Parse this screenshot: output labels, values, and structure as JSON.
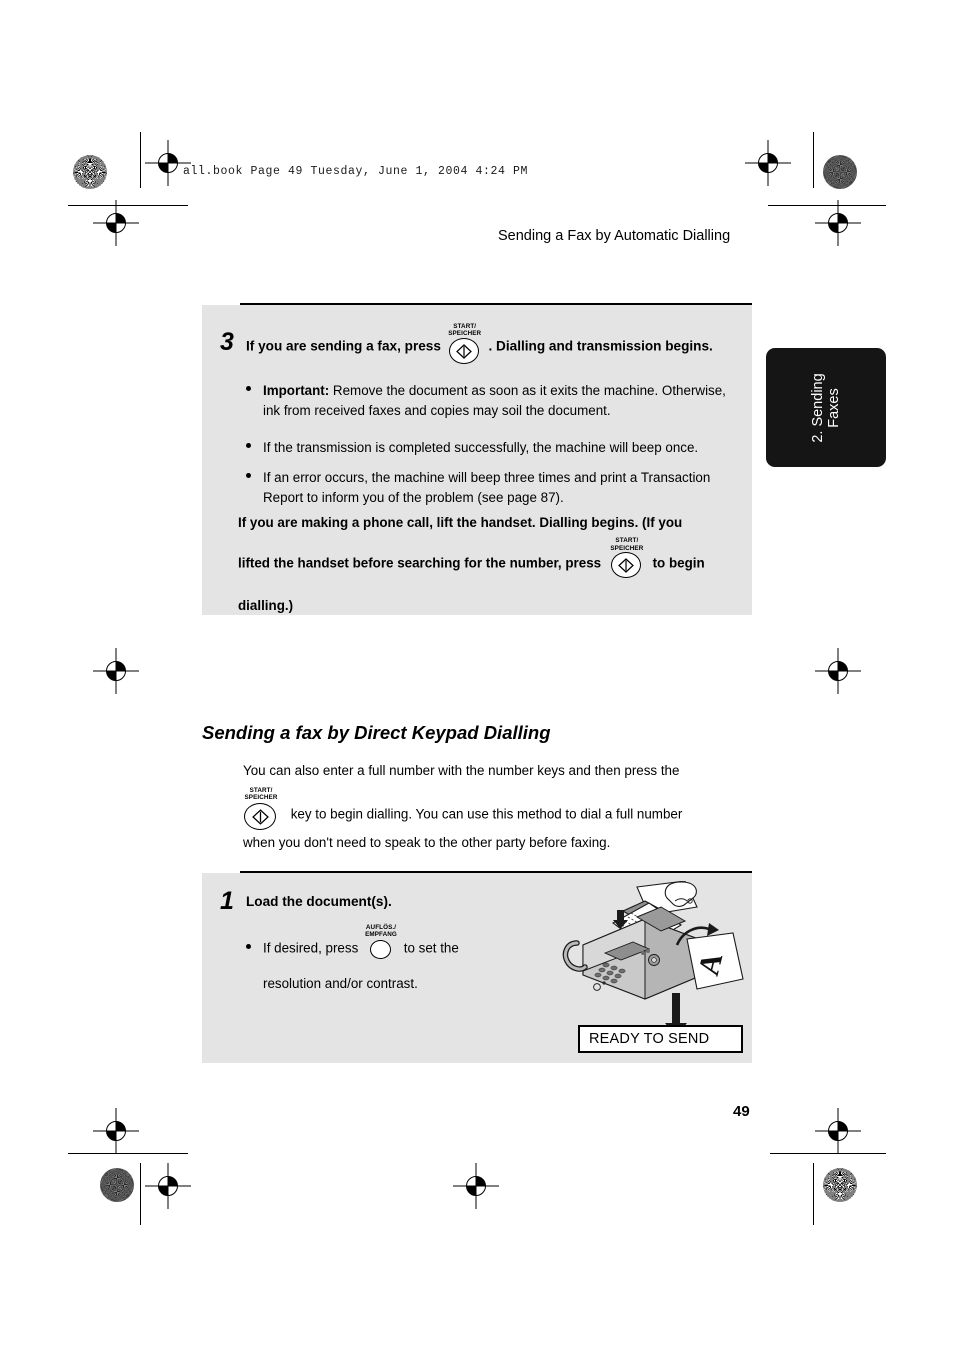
{
  "print_header": {
    "text": "all.book  Page 49  Tuesday, June 1, 2004  4:24 PM"
  },
  "running_head": {
    "title": "Sending a Fax by Automatic Dialling"
  },
  "thumb_tab": {
    "line1": "2. Sending",
    "line2": "Faxes"
  },
  "keys": {
    "start": {
      "cap_line1": "START/",
      "cap_line2": "SPEICHER",
      "name": "start-speicher-key"
    },
    "resolution": {
      "cap_line1": "AUFLÖS./",
      "cap_line2": "EMPFANG",
      "name": "auflos-empfang-key"
    }
  },
  "step3": {
    "number": "3",
    "heading_before_key": "If you are sending a fax, press",
    "heading_after_key": ". Dialling and transmission begins.",
    "bullets": [
      {
        "lead": "Important:",
        "text": " Remove the document as soon as it exits the machine. Otherwise, ink from received faxes and copies may soil the document."
      },
      {
        "lead": "",
        "text": "If the transmission is completed successfully, the machine will beep once."
      },
      {
        "lead": "",
        "text": "If an error occurs, the machine will beep three times and print a Transaction Report to inform you of the problem (see page 87)."
      }
    ],
    "note_part1": "If you are making a phone call, lift the handset. Dialling begins. (If you",
    "note_part2": "lifted the handset before searching for the number, press",
    "note_part3": "to begin",
    "note_part4": "dialling.)"
  },
  "section": {
    "title": "Sending a fax by Direct Keypad Dialling",
    "intro_part1": "You can also enter a full number with the number keys and then press the",
    "intro_part2": "key to begin dialling. You can use this method to dial a full number",
    "intro_part3": "when you don't need to speak to the other party before faxing."
  },
  "step1": {
    "number": "1",
    "heading": "Load the document(s).",
    "bullet_part1": "If desired, press",
    "bullet_part2": "to set the",
    "bullet_part3": "resolution and/or contrast."
  },
  "illustration": {
    "lcd_message": "READY TO SEND",
    "page_letter": "A"
  },
  "folio": {
    "page_number": "49"
  },
  "colors": {
    "box_gray": "#e4e4e4",
    "tab_black": "#151515",
    "ink": "#000000"
  }
}
